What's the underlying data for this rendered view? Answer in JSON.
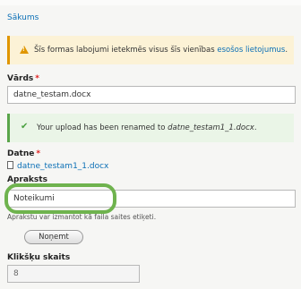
{
  "breadcrumb": "Sākums",
  "warning": {
    "icon": "warning-icon",
    "text": "Šīs formas labojumi ietekmēs visus šīs vienības ",
    "link": "esošos lietojumus",
    "suffix": "."
  },
  "name_field": {
    "label": "Vārds",
    "required": "*",
    "value": "datne_testam.docx"
  },
  "success": {
    "icon": "check-icon",
    "text": "Your upload has been renamed to ",
    "filename": "datne_testam1_1.docx",
    "suffix": "."
  },
  "file_field": {
    "label": "Datne",
    "required": "*",
    "file_icon": "file-icon",
    "link": "datne_testam1_1.docx"
  },
  "description_field": {
    "label": "Apraksts",
    "value": "Noteikumi",
    "help": "Aprakstu var izmantot kā faila saites etiķeti."
  },
  "remove_button": "Noņemt",
  "clicks_field": {
    "label": "Klikšķu skaits",
    "value": "8"
  },
  "colors": {
    "link": "#0b6fb6",
    "warning": "#e09600",
    "success": "#5aa54a",
    "highlight": "#6fb34e"
  }
}
